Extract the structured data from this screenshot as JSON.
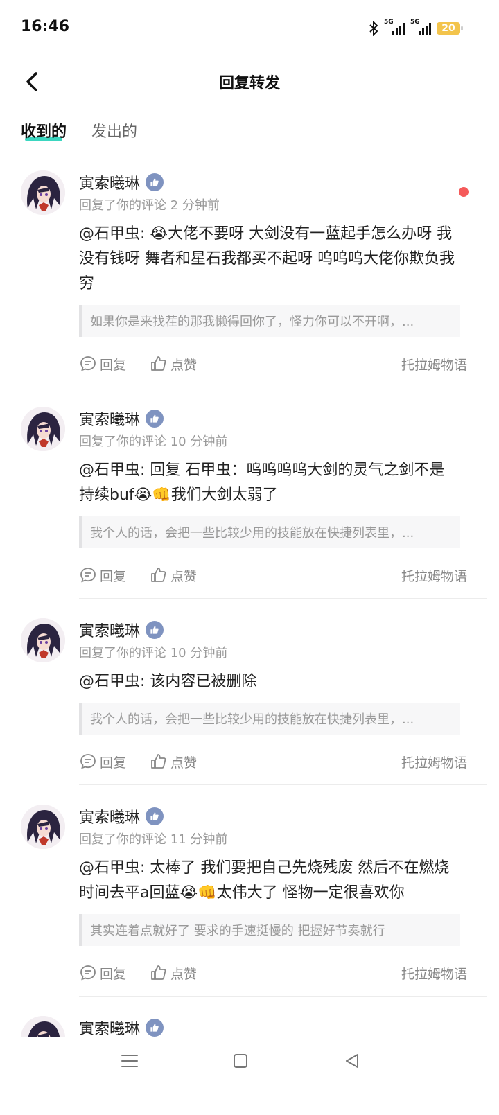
{
  "status_bar": {
    "time": "16:46",
    "battery": "20",
    "signal1": "5G",
    "signal2": "5G"
  },
  "header": {
    "title": "回复转发"
  },
  "tabs": [
    {
      "label": "收到的",
      "active": true
    },
    {
      "label": "发出的",
      "active": false
    }
  ],
  "actions": {
    "reply": "回复",
    "like": "点赞"
  },
  "items": [
    {
      "name": "寅索曦琳",
      "meta": "回复了你的评论 2 分钟前",
      "text": "@石甲虫: 😭大佬不要呀 大剑没有一蓝起手怎么办呀 我没有钱呀 舞者和星石我都买不起呀 呜呜呜大佬你欺负我穷",
      "quote": "如果你是来找茬的那我懒得回你了，怪力你可以不开啊，...",
      "game": "托拉姆物语",
      "unread": true
    },
    {
      "name": "寅索曦琳",
      "meta": "回复了你的评论 10 分钟前",
      "text": "@石甲虫: 回复 石甲虫：呜呜呜呜大剑的灵气之剑不是持续buf😭👊我们大剑太弱了",
      "quote": "我个人的话，会把一些比较少用的技能放在快捷列表里，...",
      "game": "托拉姆物语",
      "unread": false
    },
    {
      "name": "寅索曦琳",
      "meta": "回复了你的评论 10 分钟前",
      "text": "@石甲虫: 该内容已被删除",
      "quote": "我个人的话，会把一些比较少用的技能放在快捷列表里，...",
      "game": "托拉姆物语",
      "unread": false
    },
    {
      "name": "寅索曦琳",
      "meta": "回复了你的评论 11 分钟前",
      "text": "@石甲虫: 太棒了 我们要把自己先烧残废 然后不在燃烧时间去平a回蓝😭👊太伟大了 怪物一定很喜欢你",
      "quote": "其实连着点就好了 要求的手速挺慢的 把握好节奏就行",
      "game": "托拉姆物语",
      "unread": false
    },
    {
      "name": "寅索曦琳"
    }
  ]
}
